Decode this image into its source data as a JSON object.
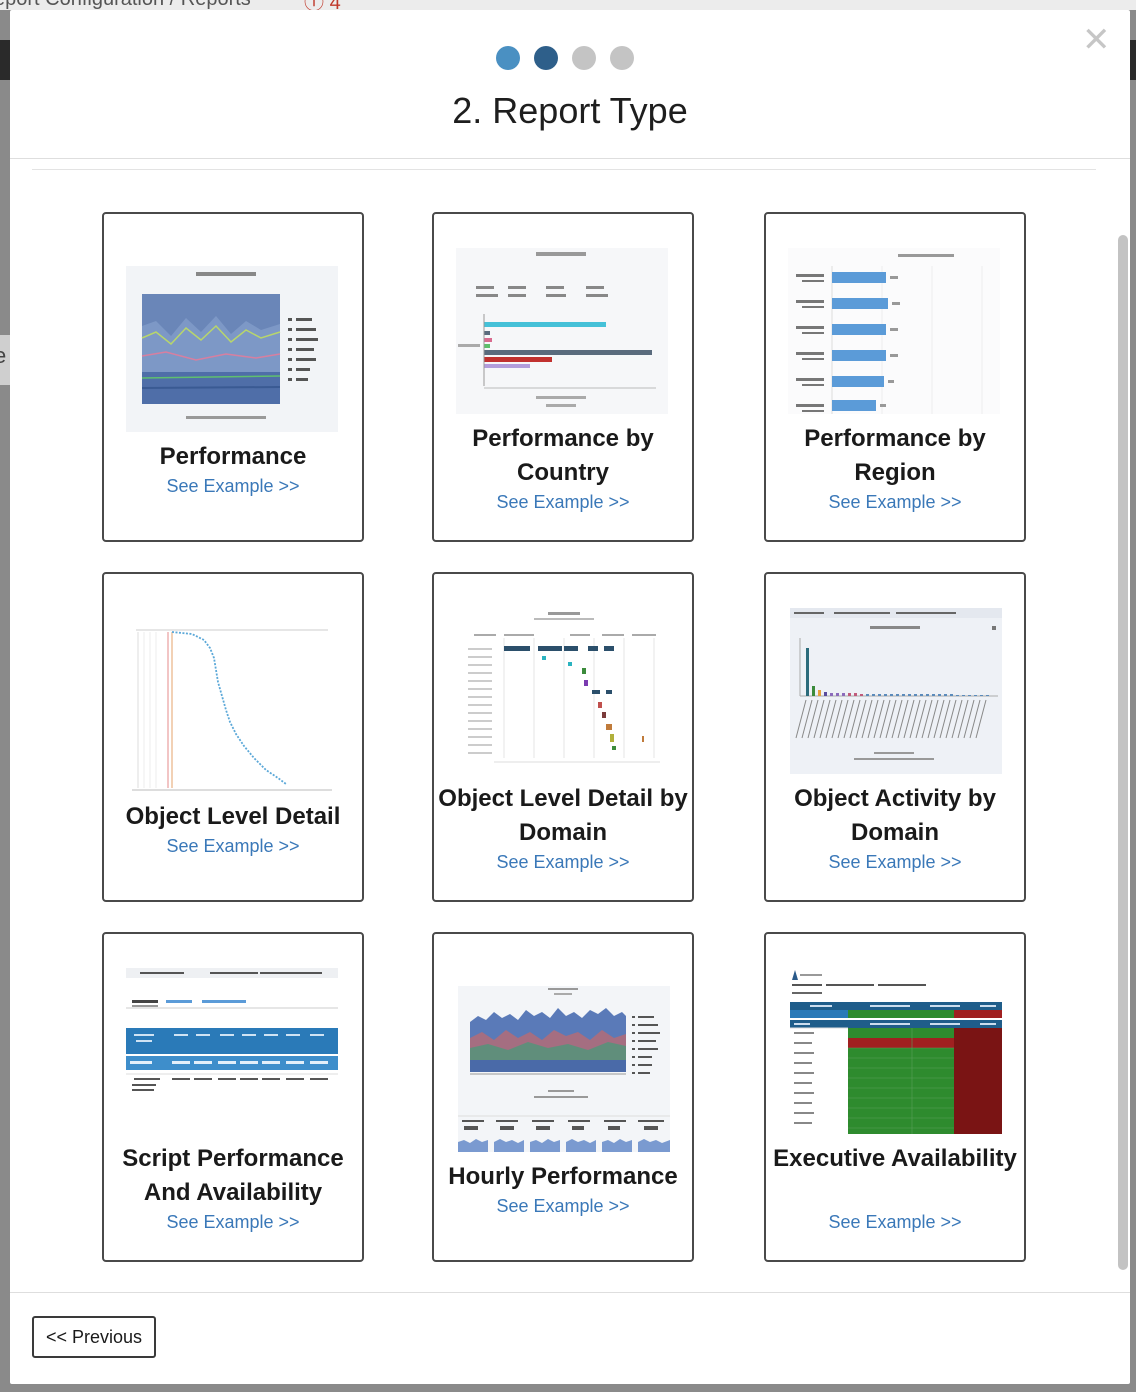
{
  "background": {
    "breadcrumb": "eport Configuration / Reports",
    "alert_count": "4"
  },
  "wizard": {
    "title": "2. Report Type",
    "steps": [
      {
        "state": "done",
        "color": "#4a90c2"
      },
      {
        "state": "active",
        "color": "#2e5f8a"
      },
      {
        "state": "pending",
        "color": "#c4c4c4"
      },
      {
        "state": "pending",
        "color": "#c4c4c4"
      }
    ],
    "close_icon": "close-icon"
  },
  "cards": [
    {
      "title": "Performance",
      "link": "See Example >>",
      "thumb": "stacked-area-chart"
    },
    {
      "title": "Performance by Country",
      "link": "See Example >>",
      "thumb": "horizontal-bar-chart"
    },
    {
      "title": "Performance by Region",
      "link": "See Example >>",
      "thumb": "horizontal-bar-chart"
    },
    {
      "title": "Object Level Detail",
      "link": "See Example >>",
      "thumb": "waterfall-scatter"
    },
    {
      "title": "Object Level Detail by Domain",
      "link": "See Example >>",
      "thumb": "gantt-chart"
    },
    {
      "title": "Object Activity by Domain",
      "link": "See Example >>",
      "thumb": "bar-chart"
    },
    {
      "title": "Script Performance And Availability",
      "link": "See Example >>",
      "thumb": "data-table"
    },
    {
      "title": "Hourly Performance",
      "link": "See Example >>",
      "thumb": "area-chart-with-sparklines"
    },
    {
      "title": "Executive Availability",
      "link": "See Example >>",
      "thumb": "heatmap-table"
    }
  ],
  "footer": {
    "previous_label": "<< Previous"
  },
  "colors": {
    "link": "#3a78b8",
    "card_border": "#4a4a4a",
    "heatmap_green": "#2e8b2e",
    "heatmap_red": "#8b1a1a",
    "table_blue": "#2a7ab8"
  }
}
